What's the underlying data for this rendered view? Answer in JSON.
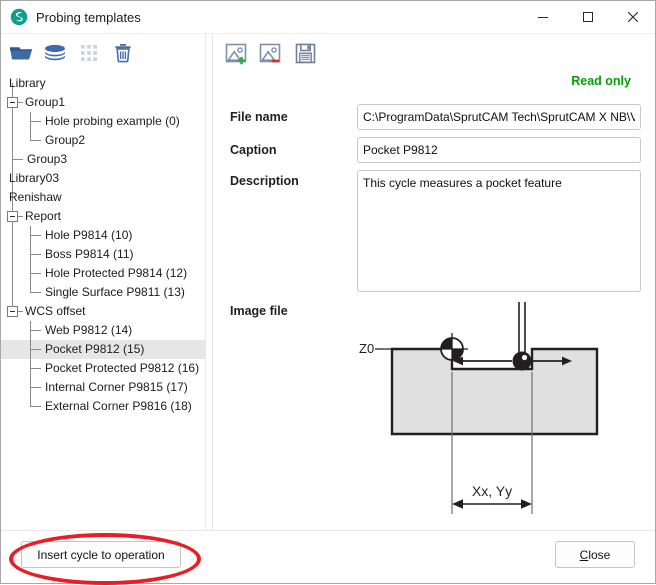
{
  "window": {
    "title": "Probing templates",
    "app_icon": "sprutcam-spiral-logo",
    "controls": {
      "minimize": "minimize-icon",
      "maximize": "maximize-icon",
      "close": "close-icon"
    }
  },
  "left_toolbar": [
    {
      "name": "open-library-button",
      "icon": "folder-icon",
      "enabled": true
    },
    {
      "name": "library-stack-button",
      "icon": "layers-icon",
      "enabled": true
    },
    {
      "name": "grid-button",
      "icon": "grid-icon",
      "enabled": false
    },
    {
      "name": "delete-button",
      "icon": "trash-icon",
      "enabled": true
    }
  ],
  "tree": {
    "nodes": [
      {
        "label": "Library",
        "depth": 0,
        "expander": "none",
        "selected": false
      },
      {
        "label": "Group1",
        "depth": 0,
        "expander": "expanded",
        "selected": false
      },
      {
        "label": "Hole probing example (0)",
        "depth": 2,
        "expander": "none",
        "selected": false
      },
      {
        "label": "Group2",
        "depth": 2,
        "expander": "none",
        "selected": false
      },
      {
        "label": "Group3",
        "depth": 1,
        "expander": "none",
        "selected": false
      },
      {
        "label": "Library03",
        "depth": 0,
        "expander": "none",
        "selected": false
      },
      {
        "label": "Renishaw",
        "depth": 0,
        "expander": "none",
        "selected": false
      },
      {
        "label": "Report",
        "depth": 0,
        "expander": "expanded",
        "selected": false
      },
      {
        "label": "Hole P9814 (10)",
        "depth": 2,
        "expander": "none",
        "selected": false
      },
      {
        "label": "Boss P9814 (11)",
        "depth": 2,
        "expander": "none",
        "selected": false
      },
      {
        "label": "Hole Protected P9814 (12)",
        "depth": 2,
        "expander": "none",
        "selected": false
      },
      {
        "label": "Single Surface P9811 (13)",
        "depth": 2,
        "expander": "none",
        "selected": false
      },
      {
        "label": "WCS offset",
        "depth": 0,
        "expander": "expanded",
        "selected": false
      },
      {
        "label": "Web P9812 (14)",
        "depth": 2,
        "expander": "none",
        "selected": false
      },
      {
        "label": "Pocket P9812 (15)",
        "depth": 2,
        "expander": "none",
        "selected": true
      },
      {
        "label": "Pocket Protected P9812 (16)",
        "depth": 2,
        "expander": "none",
        "selected": false
      },
      {
        "label": "Internal Corner P9815 (17)",
        "depth": 2,
        "expander": "none",
        "selected": false
      },
      {
        "label": "External Corner P9816 (18)",
        "depth": 2,
        "expander": "none",
        "selected": false
      }
    ]
  },
  "right_toolbar": [
    {
      "name": "add-image-button",
      "icon": "image-add-icon"
    },
    {
      "name": "remove-image-button",
      "icon": "image-remove-icon"
    },
    {
      "name": "save-button",
      "icon": "floppy-save-icon"
    }
  ],
  "details": {
    "read_only_label": "Read only",
    "read_only_color": "#00a200",
    "file_name_label": "File name",
    "file_name_value": "C:\\ProgramData\\SprutCAM Tech\\SprutCAM X NB\\Version",
    "file_name_placeholder": "",
    "caption_label": "Caption",
    "caption_value": "Pocket P9812",
    "caption_placeholder": "",
    "description_label": "Description",
    "description_value": "This cycle measures a pocket feature",
    "description_placeholder": "",
    "image_file_label": "Image file"
  },
  "diagram": {
    "name": "pocket-probing-diagram",
    "origin_label": "Z0",
    "dimension_label": "Xx, Yy",
    "fill_color": "#e0e0e0",
    "stroke_color": "#231f20"
  },
  "footer": {
    "insert_label": "Insert cycle to operation",
    "close_label_prefix": "",
    "close_label_accel": "C",
    "close_label_rest": "lose",
    "annotation_color": "#ec1c24"
  }
}
